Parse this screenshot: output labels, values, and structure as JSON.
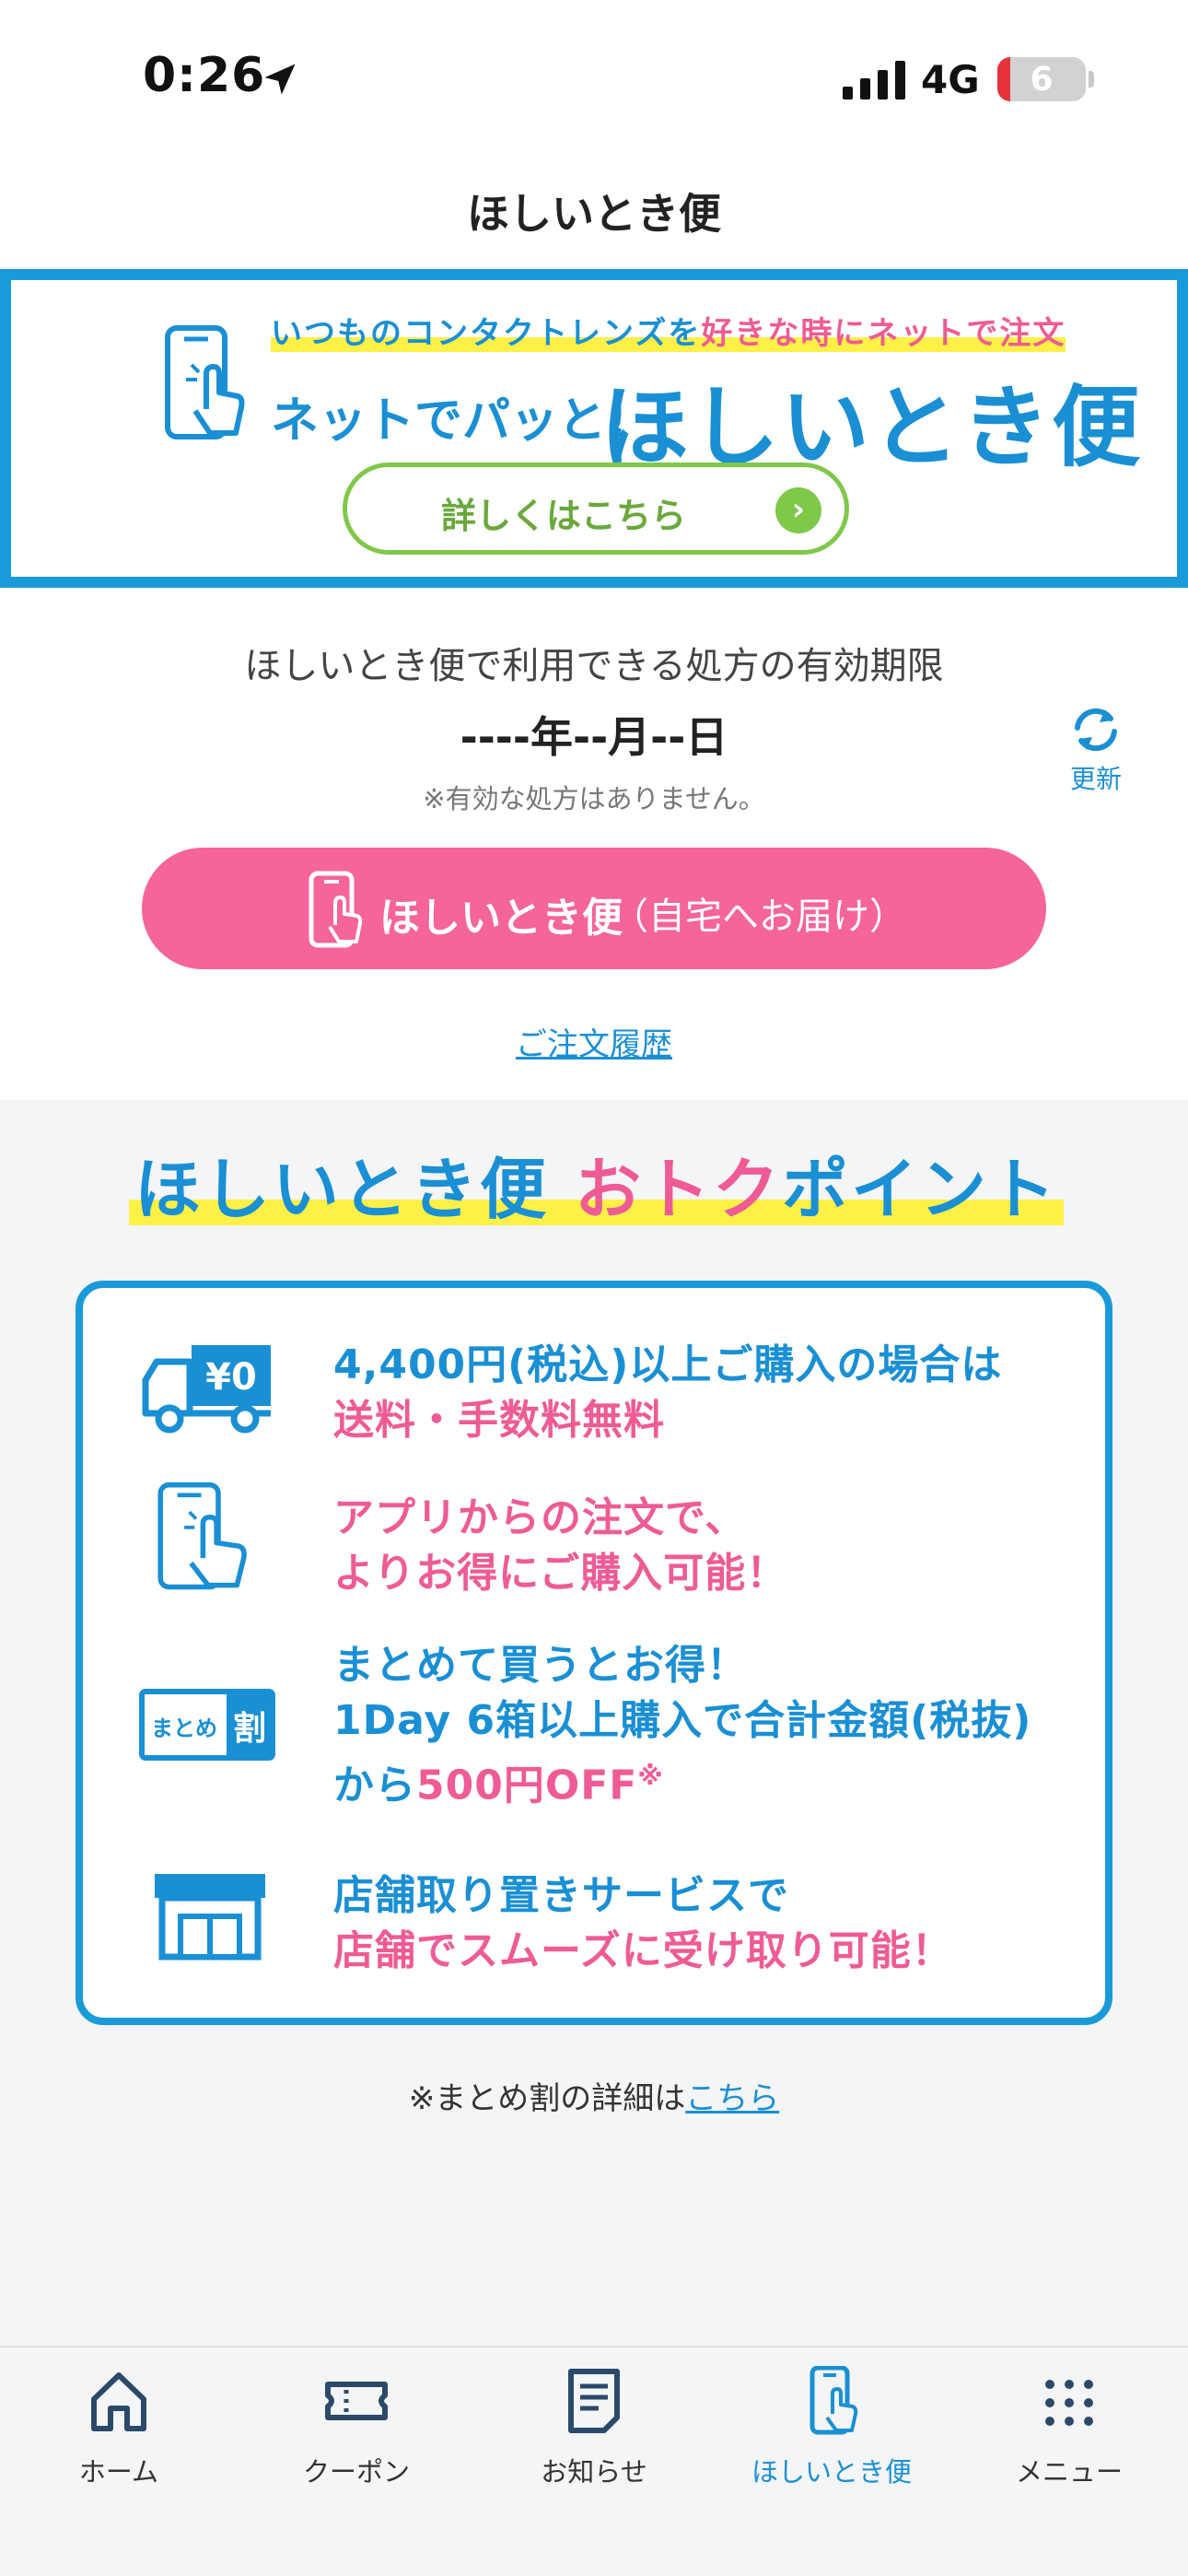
{
  "status_bar": {
    "time": "0:26",
    "network": "4G",
    "battery": "6"
  },
  "header": {
    "title": "ほしいとき便"
  },
  "banner": {
    "tagline_part1": "いつものコンタクトレンズを",
    "tagline_part2": "好きな時にネットで注文",
    "subtitle_small": "ネットでパッと!",
    "subtitle_big": "ほしいとき便",
    "button_label": "詳しくはこちら"
  },
  "prescription": {
    "title": "ほしいとき便で利用できる処方の有効期限",
    "date": "----年--月--日",
    "note": "※有効な処方はありません。",
    "refresh_label": "更新"
  },
  "order_button": {
    "label_bold": "ほしいとき便",
    "label_sub": "（自宅へお届け）"
  },
  "history_link": "ご注文履歴",
  "benefits": {
    "heading_blue": "ほしいとき便 ",
    "heading_pink": "おトク",
    "heading_blue2": "ポイント",
    "items": [
      {
        "line1": "4,400円(税込)以上ご購入の場合は",
        "line2": "送料・手数料無料",
        "icon_badge": "¥0"
      },
      {
        "line1": "アプリからの注文で、",
        "line2": "よりお得にご購入可能！"
      },
      {
        "line1": "まとめて買うとお得！",
        "line2": "1Day 6箱以上購入で合計金額(税抜)",
        "line3_blue": "から",
        "line3_pink": "500円OFF",
        "line3_mark": "※",
        "icon_badge_left": "まとめ",
        "icon_badge_right": "割"
      },
      {
        "line1": "店舗取り置きサービスで",
        "line2": "店舗でスムーズに受け取り可能！"
      }
    ]
  },
  "matome_note": {
    "text": "※まとめ割の詳細は",
    "link": "こちら"
  },
  "nav": {
    "items": [
      {
        "label": "ホーム"
      },
      {
        "label": "クーポン"
      },
      {
        "label": "お知らせ"
      },
      {
        "label": "ほしいとき便"
      },
      {
        "label": "メニュー"
      }
    ],
    "active_color": "#1a8fd4"
  },
  "colors": {
    "brand_blue": "#1a8fd4",
    "accent_pink": "#f5649a",
    "highlight_yellow": "#fff047",
    "banner_button_green": "#7fc84a"
  }
}
